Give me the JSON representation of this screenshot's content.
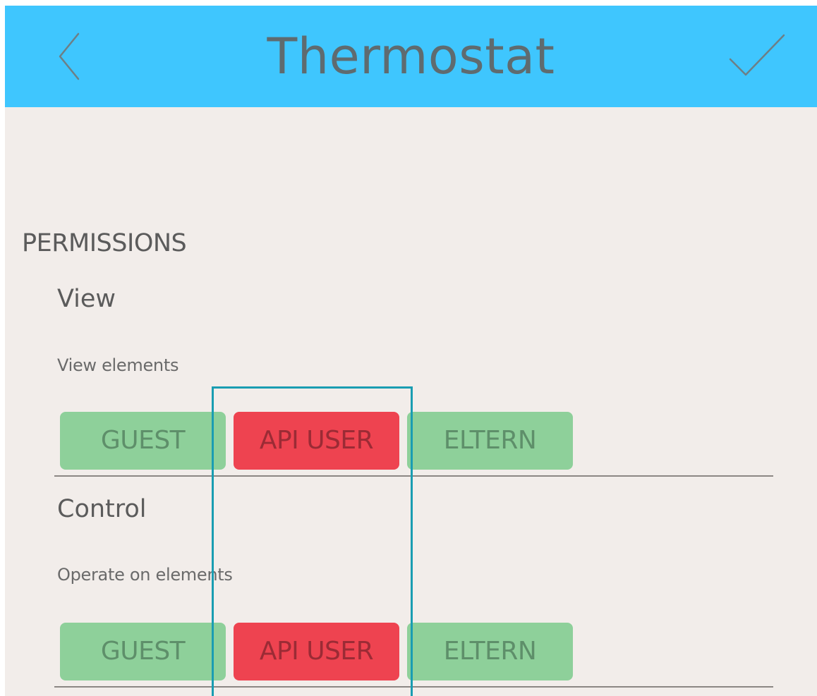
{
  "header": {
    "title": "Thermostat",
    "back_icon": "chevron-left-icon",
    "confirm_icon": "checkmark-icon",
    "background_color": "#3fc6fe"
  },
  "section": {
    "title": "PERMISSIONS"
  },
  "permissions": [
    {
      "title": "View",
      "description": "View elements",
      "roles": [
        {
          "label": "GUEST",
          "selected": false
        },
        {
          "label": "API USER",
          "selected": true
        },
        {
          "label": "ELTERN",
          "selected": false
        }
      ]
    },
    {
      "title": "Control",
      "description": "Operate on elements",
      "roles": [
        {
          "label": "GUEST",
          "selected": false
        },
        {
          "label": "API USER",
          "selected": true
        },
        {
          "label": "ELTERN",
          "selected": false
        }
      ]
    }
  ],
  "colors": {
    "role_unselected": "#8ed09a",
    "role_selected": "#ee4350",
    "highlight_outline": "#1a9db2"
  }
}
